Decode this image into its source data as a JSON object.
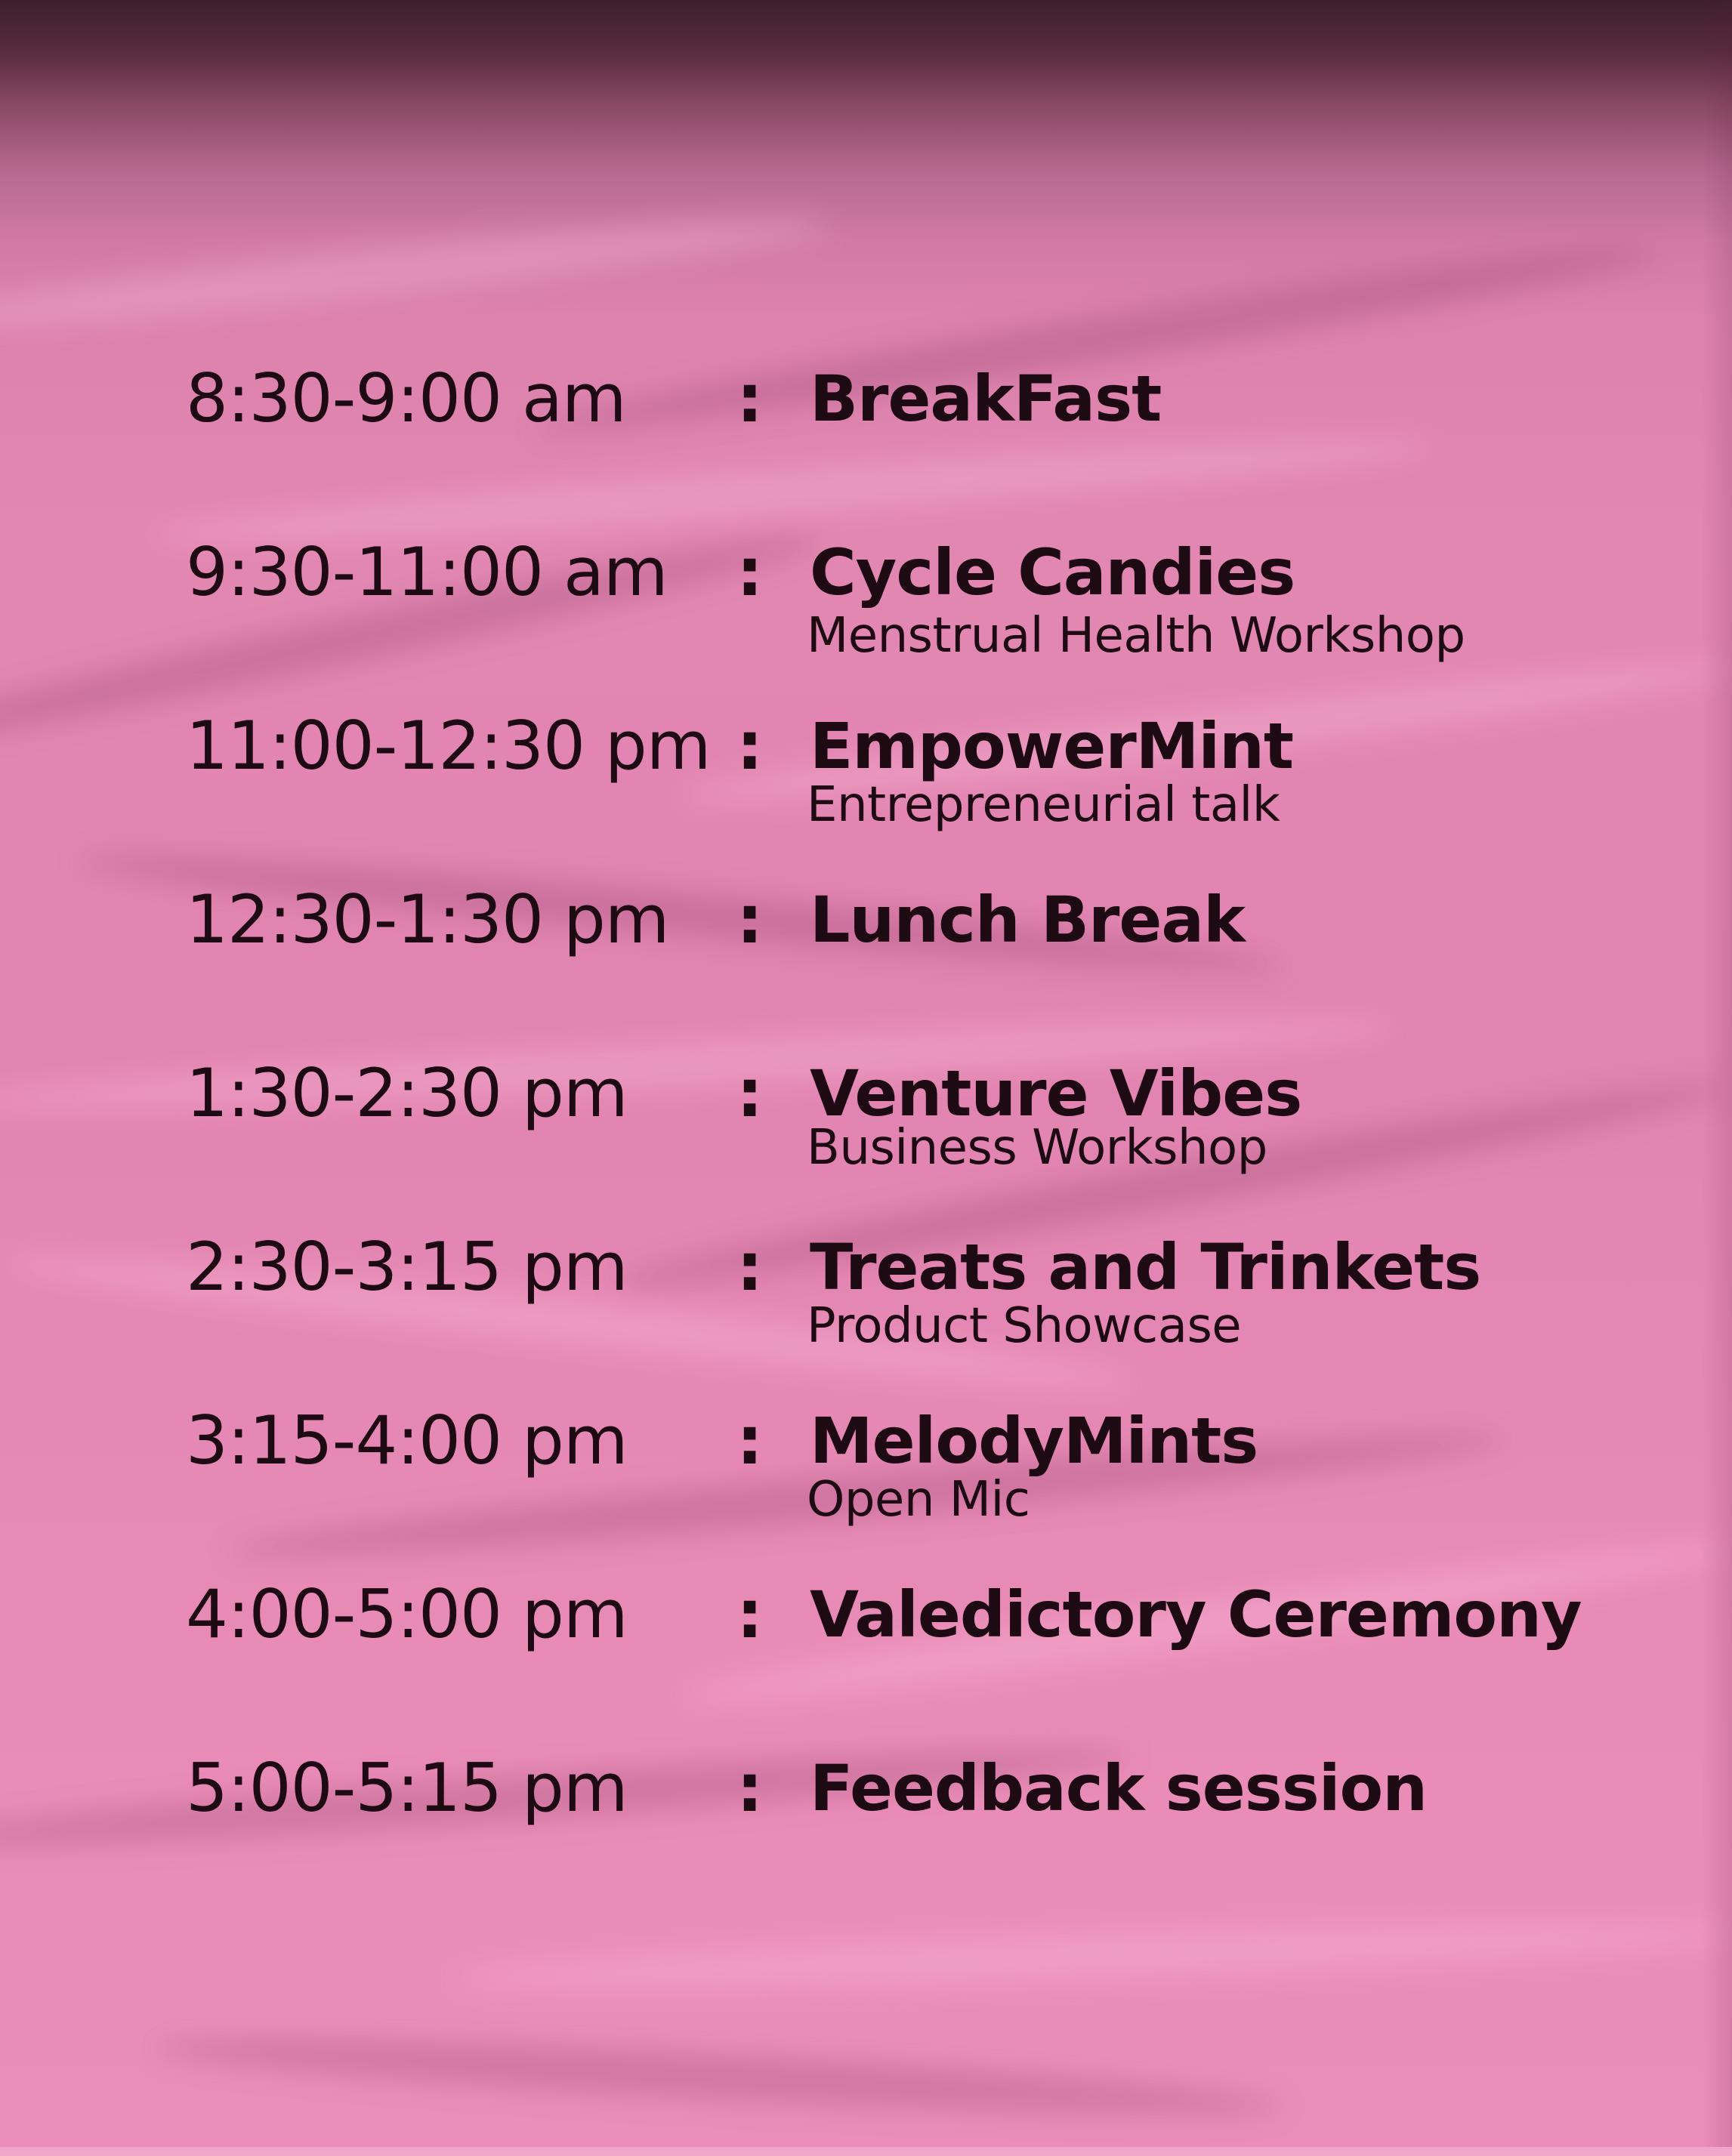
{
  "colors": {
    "paper": "#e286b2",
    "top_shadow": "#3d1f2c",
    "text": "#1d0a12"
  },
  "separator": ":",
  "schedule": [
    {
      "time": "8:30-9:00 am",
      "title": "BreakFast",
      "subtitle": ""
    },
    {
      "time": "9:30-11:00 am",
      "title": "Cycle Candies",
      "subtitle": "Menstrual Health Workshop"
    },
    {
      "time": "11:00-12:30 pm",
      "title": "EmpowerMint",
      "subtitle": "Entrepreneurial talk"
    },
    {
      "time": "12:30-1:30 pm",
      "title": "Lunch Break",
      "subtitle": ""
    },
    {
      "time": "1:30-2:30 pm",
      "title": "Venture Vibes",
      "subtitle": "Business Workshop"
    },
    {
      "time": "2:30-3:15 pm",
      "title": "Treats and Trinkets",
      "subtitle": "Product Showcase"
    },
    {
      "time": "3:15-4:00 pm",
      "title": "MelodyMints",
      "subtitle": "Open Mic"
    },
    {
      "time": "4:00-5:00 pm",
      "title": "Valedictory Ceremony",
      "subtitle": ""
    },
    {
      "time": "5:00-5:15 pm",
      "title": "Feedback session",
      "subtitle": ""
    }
  ]
}
